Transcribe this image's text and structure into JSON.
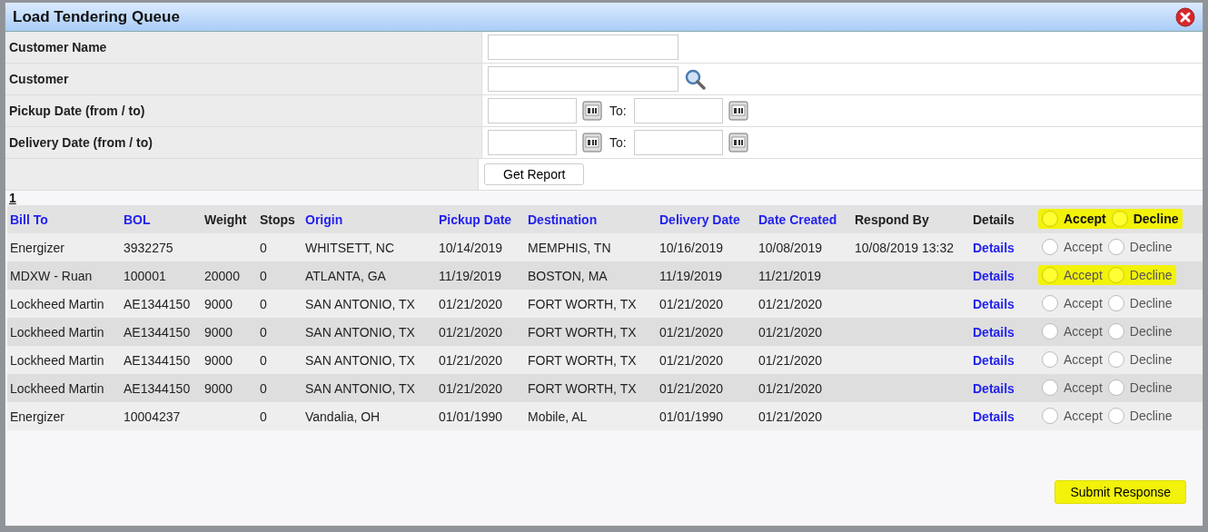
{
  "window": {
    "title": "Load Tendering Queue"
  },
  "filters": [
    {
      "kind": "text",
      "label": "Customer Name"
    },
    {
      "kind": "lookup",
      "label": "Customer"
    },
    {
      "kind": "daterange",
      "label": "Pickup Date (from / to)",
      "to_label": "To:"
    },
    {
      "kind": "daterange",
      "label": "Delivery Date (from / to)",
      "to_label": "To:"
    }
  ],
  "get_report_button": "Get Report",
  "page_link": "1",
  "table": {
    "columns": [
      {
        "label": "Bill To",
        "sortable": true
      },
      {
        "label": "BOL",
        "sortable": true
      },
      {
        "label": "Weight",
        "sortable": false
      },
      {
        "label": "Stops",
        "sortable": false
      },
      {
        "label": "Origin",
        "sortable": true
      },
      {
        "label": "Pickup Date",
        "sortable": true
      },
      {
        "label": "Destination",
        "sortable": true
      },
      {
        "label": "Delivery Date",
        "sortable": true
      },
      {
        "label": "Date Created",
        "sortable": true
      },
      {
        "label": "Respond By",
        "sortable": false
      },
      {
        "label": "Details",
        "sortable": false
      }
    ],
    "header_actions": {
      "accept": "Accept",
      "decline": "Decline",
      "highlighted": true
    },
    "rows": [
      {
        "cells": [
          "Energizer",
          "3932275",
          "",
          "0",
          "WHITSETT, NC",
          "10/14/2019",
          "MEMPHIS, TN",
          "10/16/2019",
          "10/08/2019",
          "10/08/2019 13:32"
        ],
        "details": "Details",
        "accept": "Accept",
        "decline": "Decline",
        "highlighted": false
      },
      {
        "cells": [
          "MDXW - Ruan",
          "100001",
          "20000",
          "0",
          "ATLANTA, GA",
          "11/19/2019",
          "BOSTON, MA",
          "11/19/2019",
          "11/21/2019",
          ""
        ],
        "details": "Details",
        "accept": "Accept",
        "decline": "Decline",
        "highlighted": true
      },
      {
        "cells": [
          "Lockheed Martin",
          "AE1344150",
          "9000",
          "0",
          "SAN ANTONIO, TX",
          "01/21/2020",
          "FORT WORTH, TX",
          "01/21/2020",
          "01/21/2020",
          ""
        ],
        "details": "Details",
        "accept": "Accept",
        "decline": "Decline",
        "highlighted": false
      },
      {
        "cells": [
          "Lockheed Martin",
          "AE1344150",
          "9000",
          "0",
          "SAN ANTONIO, TX",
          "01/21/2020",
          "FORT WORTH, TX",
          "01/21/2020",
          "01/21/2020",
          ""
        ],
        "details": "Details",
        "accept": "Accept",
        "decline": "Decline",
        "highlighted": false
      },
      {
        "cells": [
          "Lockheed Martin",
          "AE1344150",
          "9000",
          "0",
          "SAN ANTONIO, TX",
          "01/21/2020",
          "FORT WORTH, TX",
          "01/21/2020",
          "01/21/2020",
          ""
        ],
        "details": "Details",
        "accept": "Accept",
        "decline": "Decline",
        "highlighted": false
      },
      {
        "cells": [
          "Lockheed Martin",
          "AE1344150",
          "9000",
          "0",
          "SAN ANTONIO, TX",
          "01/21/2020",
          "FORT WORTH, TX",
          "01/21/2020",
          "01/21/2020",
          ""
        ],
        "details": "Details",
        "accept": "Accept",
        "decline": "Decline",
        "highlighted": false
      },
      {
        "cells": [
          "Energizer",
          "10004237",
          "",
          "0",
          "Vandalia, OH",
          "01/01/1990",
          "Mobile, AL",
          "01/01/1990",
          "01/21/2020",
          ""
        ],
        "details": "Details",
        "accept": "Accept",
        "decline": "Decline",
        "highlighted": false
      }
    ]
  },
  "submit": {
    "label": "Submit Response",
    "highlighted": true
  }
}
